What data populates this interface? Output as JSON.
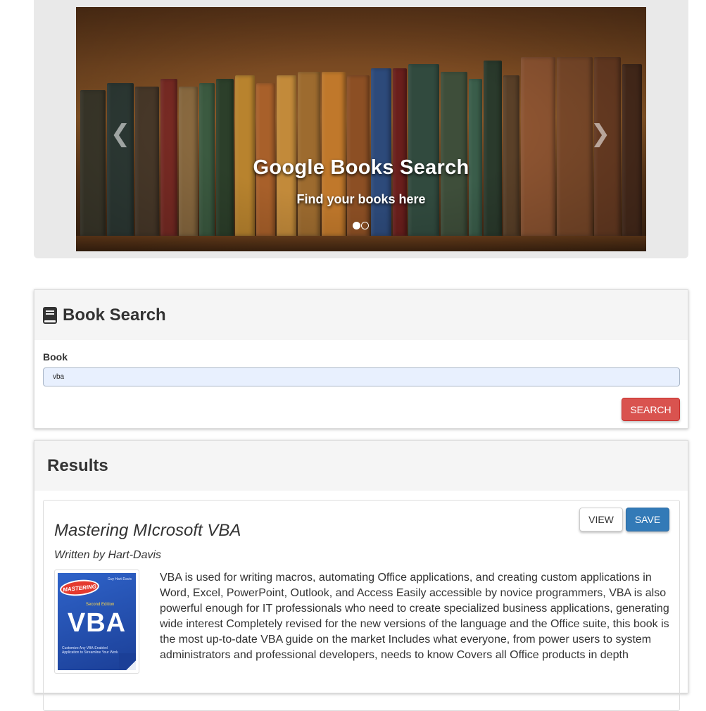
{
  "carousel": {
    "title": "Google Books Search",
    "subtitle": "Find your books here",
    "prev_icon": "chevron-left-icon",
    "next_icon": "chevron-right-icon",
    "prev_glyph": "❮",
    "next_glyph": "❯",
    "active_slide": 1,
    "slide_count": 2
  },
  "search": {
    "heading": "Book Search",
    "heading_icon": "book-icon",
    "label": "Book",
    "value": "vba",
    "button_label": "SEARCH",
    "button_color": "#d9534f"
  },
  "results": {
    "heading": "Results",
    "items": [
      {
        "title": "Mastering MIcrosoft VBA",
        "author": "Written by Hart-Davis",
        "view_label": "VIEW",
        "save_label": "SAVE",
        "save_color": "#337ab7",
        "cover": {
          "badge": "MASTERING",
          "edition": "Second Edition",
          "big_text": "VBA",
          "author": "Guy Hart-Davis",
          "subtitle": "Customize Any VBA-Enabled Application to Streamline Your Work"
        },
        "description": "VBA is used for writing macros, automating Office applications, and creating custom applications in Word, Excel, PowerPoint, Outlook, and Access Easily accessible by novice programmers, VBA is also powerful enough for IT professionals who need to create specialized business applications, generating wide interest Completely revised for the new versions of the language and the Office suite, this book is the most up-to-date VBA guide on the market Includes what everyone, from power users to system administrators and professional developers, needs to know Covers all Office products in depth"
      }
    ]
  }
}
